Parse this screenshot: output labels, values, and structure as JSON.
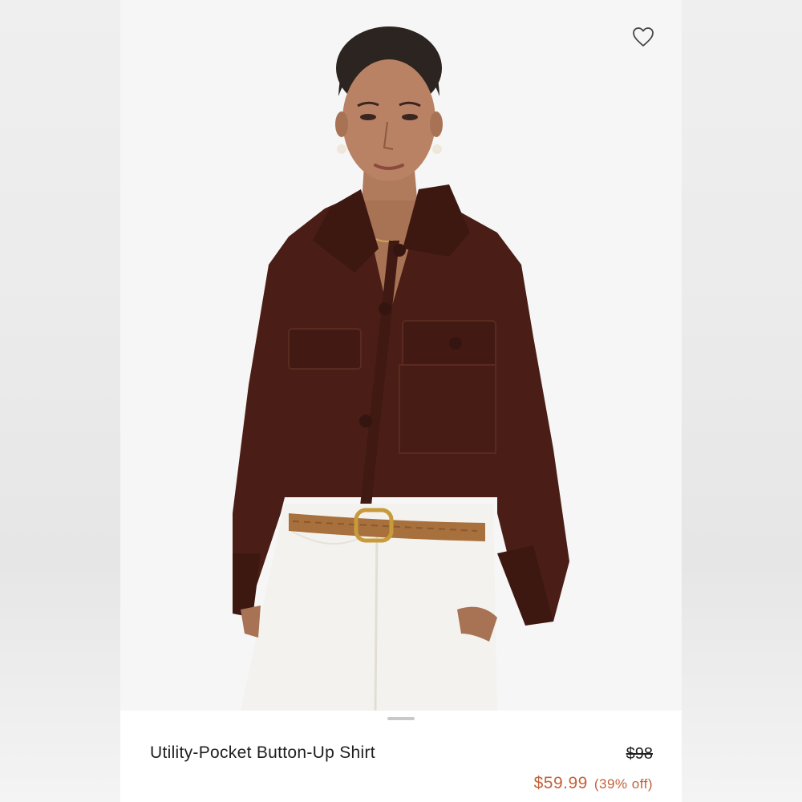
{
  "product": {
    "name": "Utility-Pocket Button-Up Shirt",
    "original_price": "$98",
    "sale_price": "$59.99",
    "discount": "(39% off)"
  },
  "image": {
    "alt": "Model wearing brown utility-pocket button-up shirt with braided belt and white trousers"
  },
  "icons": {
    "favorite": "heart-outline-icon"
  },
  "colors": {
    "shirt": "#4a1e16",
    "sale_price": "#c4603a",
    "text": "#1f1f1f",
    "belt": "#a8703d",
    "pants": "#f4f2ee"
  }
}
